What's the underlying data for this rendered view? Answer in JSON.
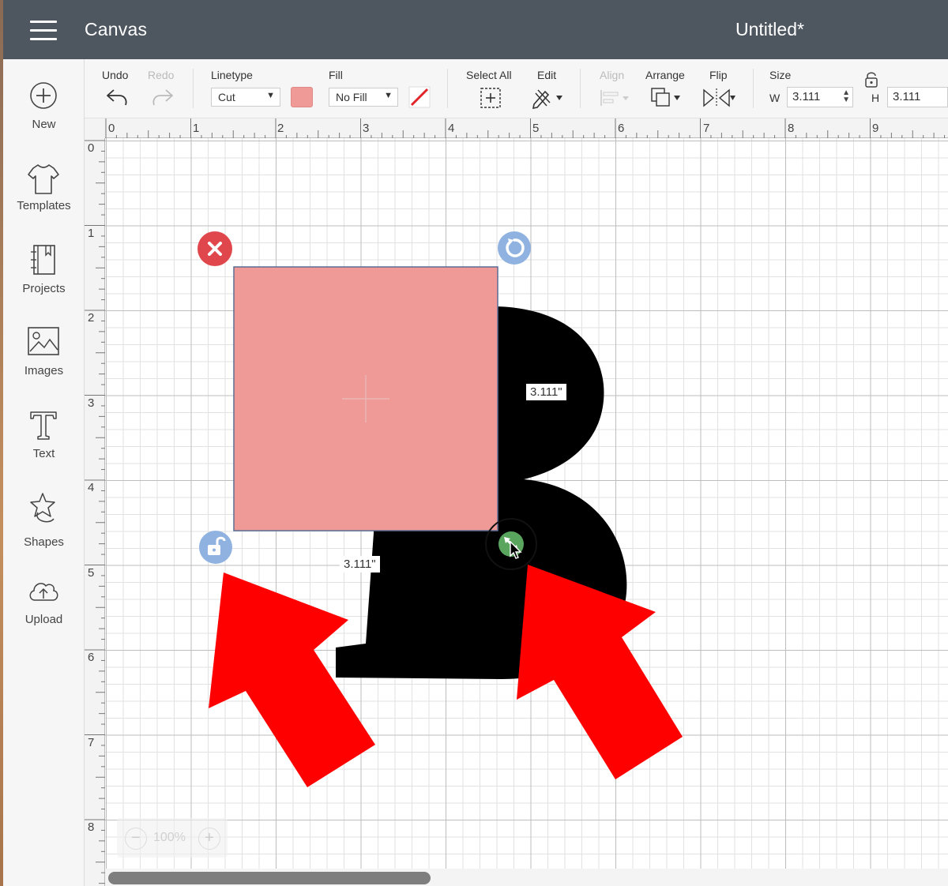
{
  "header": {
    "title": "Canvas",
    "document_title": "Untitled*"
  },
  "sidebar": {
    "items": [
      {
        "label": "New",
        "icon": "plus-circle-icon"
      },
      {
        "label": "Templates",
        "icon": "tshirt-icon"
      },
      {
        "label": "Projects",
        "icon": "notebook-icon"
      },
      {
        "label": "Images",
        "icon": "picture-icon"
      },
      {
        "label": "Text",
        "icon": "text-t-icon"
      },
      {
        "label": "Shapes",
        "icon": "shapes-icon"
      },
      {
        "label": "Upload",
        "icon": "cloud-upload-icon"
      }
    ]
  },
  "toolbar": {
    "undo_label": "Undo",
    "redo_label": "Redo",
    "linetype_label": "Linetype",
    "linetype_value": "Cut",
    "fill_label": "Fill",
    "fill_value": "No Fill",
    "select_all_label": "Select All",
    "edit_label": "Edit",
    "align_label": "Align",
    "arrange_label": "Arrange",
    "flip_label": "Flip",
    "size_label": "Size",
    "width_prefix": "W",
    "width_value": "3.111",
    "height_prefix": "H",
    "height_value": "3.111",
    "fill_color": "#f09a97"
  },
  "rulers": {
    "top": [
      "0",
      "1",
      "2",
      "3",
      "4",
      "5",
      "6",
      "7",
      "8",
      "9"
    ],
    "left": [
      "0",
      "1",
      "2",
      "3",
      "4",
      "5",
      "6",
      "7",
      "8"
    ]
  },
  "canvas": {
    "shape_color": "#f09a97",
    "letter": "B",
    "width_dimension": "3.111\"",
    "height_dimension": "3.111\"",
    "zoom_level": "100%",
    "handles": {
      "delete": "delete-x-icon",
      "rotate": "rotate-icon",
      "lock": "unlock-icon",
      "resize": "resize-arrows-icon"
    }
  },
  "colors": {
    "header_bg": "#4e5760",
    "delete_handle": "#e0474c",
    "rotate_handle": "#8fb2e0",
    "resize_handle": "#5aa55e",
    "annotation_arrow": "#ff0000"
  }
}
